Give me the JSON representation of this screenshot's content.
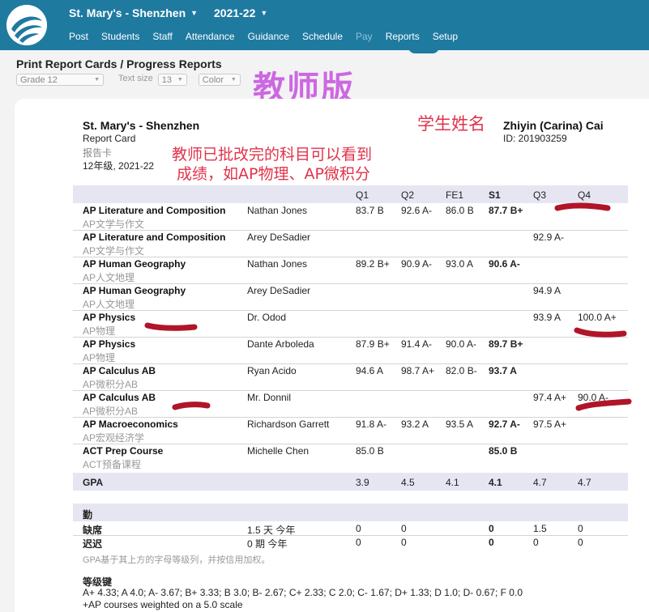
{
  "nav": {
    "school": "St. Mary's - Shenzhen",
    "year": "2021-22",
    "items": [
      {
        "label": "Post",
        "enabled": true
      },
      {
        "label": "Students",
        "enabled": true
      },
      {
        "label": "Staff",
        "enabled": true
      },
      {
        "label": "Attendance",
        "enabled": true
      },
      {
        "label": "Guidance",
        "enabled": true
      },
      {
        "label": "Schedule",
        "enabled": true
      },
      {
        "label": "Pay",
        "enabled": false
      },
      {
        "label": "Reports",
        "enabled": true
      },
      {
        "label": "Setup",
        "enabled": true
      }
    ],
    "active": "Reports"
  },
  "page": {
    "title": "Print Report Cards / Progress Reports",
    "grade_select": "Grade 12",
    "text_size_label": "Text size",
    "text_size_value": "13",
    "color_select": "Color"
  },
  "annotations": {
    "teacher_version": "教师版",
    "student_name": "学生姓名",
    "note_line1": "教师已批改完的科目可以看到",
    "note_line2": "成绩，如AP物理、AP微积分"
  },
  "report": {
    "school": "St. Mary's - Shenzhen",
    "type": "Report Card",
    "type_cn": "报告卡",
    "grade_year": "12年级, 2021-22",
    "student_name": "Zhiyin (Carina) Cai",
    "student_id": "ID: 201903259",
    "columns": [
      "Q1",
      "Q2",
      "FE1",
      "S1",
      "Q3",
      "Q4"
    ],
    "rows": [
      {
        "subject": "AP Literature and Composition",
        "subject_cn": "AP文学与作文",
        "teacher": "Nathan Jones",
        "q1": "83.7 B",
        "q2": "92.6 A-",
        "fe1": "86.0 B",
        "s1": "87.7 B+",
        "q3": "",
        "q4": ""
      },
      {
        "subject": "AP Literature and Composition",
        "subject_cn": "AP文学与作文",
        "teacher": "Arey DeSadier",
        "q1": "",
        "q2": "",
        "fe1": "",
        "s1": "",
        "q3": "92.9 A-",
        "q4": ""
      },
      {
        "subject": "AP Human Geography",
        "subject_cn": "AP人文地理",
        "teacher": "Nathan Jones",
        "q1": "89.2 B+",
        "q2": "90.9 A-",
        "fe1": "93.0 A",
        "s1": "90.6 A-",
        "q3": "",
        "q4": ""
      },
      {
        "subject": "AP Human Geography",
        "subject_cn": "AP人文地理",
        "teacher": "Arey DeSadier",
        "q1": "",
        "q2": "",
        "fe1": "",
        "s1": "",
        "q3": "94.9 A",
        "q4": ""
      },
      {
        "subject": "AP Physics",
        "subject_cn": "AP物理",
        "teacher": "Dr. Odod",
        "q1": "",
        "q2": "",
        "fe1": "",
        "s1": "",
        "q3": "93.9 A",
        "q4": "100.0 A+"
      },
      {
        "subject": "AP Physics",
        "subject_cn": "AP物理",
        "teacher": "Dante Arboleda",
        "q1": "87.9 B+",
        "q2": "91.4 A-",
        "fe1": "90.0 A-",
        "s1": "89.7 B+",
        "q3": "",
        "q4": ""
      },
      {
        "subject": "AP Calculus AB",
        "subject_cn": "AP微积分AB",
        "teacher": "Ryan Acido",
        "q1": "94.6 A",
        "q2": "98.7 A+",
        "fe1": "82.0 B-",
        "s1": "93.7 A",
        "q3": "",
        "q4": ""
      },
      {
        "subject": "AP Calculus AB",
        "subject_cn": "AP微积分AB",
        "teacher": "Mr. Donnil",
        "q1": "",
        "q2": "",
        "fe1": "",
        "s1": "",
        "q3": "97.4 A+",
        "q4": "90.0 A-"
      },
      {
        "subject": "AP Macroeconomics",
        "subject_cn": "AP宏观经济学",
        "teacher": "Richardson Garrett",
        "q1": "91.8 A-",
        "q2": "93.2 A",
        "fe1": "93.5 A",
        "s1": "92.7 A-",
        "q3": "97.5 A+",
        "q4": ""
      },
      {
        "subject": "ACT Prep Course",
        "subject_cn": "ACT预备课程",
        "teacher": "Michelle Chen",
        "q1": "85.0 B",
        "q2": "",
        "fe1": "",
        "s1": "85.0 B",
        "q3": "",
        "q4": ""
      }
    ],
    "gpa": {
      "label": "GPA",
      "q1": "3.9",
      "q2": "4.5",
      "fe1": "4.1",
      "s1": "4.1",
      "q3": "4.7",
      "q4": "4.7"
    },
    "attendance": {
      "title": "勤",
      "rows": [
        {
          "label": "缺席",
          "period": "1.5 天 今年",
          "q1": "0",
          "q2": "0",
          "s1": "0",
          "q3": "1.5",
          "q4": "0"
        },
        {
          "label": "迟迟",
          "period": "0 期 今年",
          "q1": "0",
          "q2": "0",
          "s1": "0",
          "q3": "0",
          "q4": "0"
        }
      ]
    },
    "footnote": "GPA基于其上方的字母等级列，并按信用加权。",
    "legend_title": "等级键",
    "legend_line1": "A+ 4.33; A 4.0; A- 3.67; B+ 3.33; B 3.0; B- 2.67; C+ 2.33; C 2.0; C- 1.67; D+ 1.33; D 1.0; D- 0.67; F 0.0",
    "legend_line2": "+AP courses weighted on a 5.0 scale"
  },
  "colors": {
    "nav_bg": "#1f7aa0",
    "annotation": "#e0334a",
    "marker": "#b01528",
    "watermark": "#c85ae0",
    "header_band": "#e6e6f3"
  }
}
